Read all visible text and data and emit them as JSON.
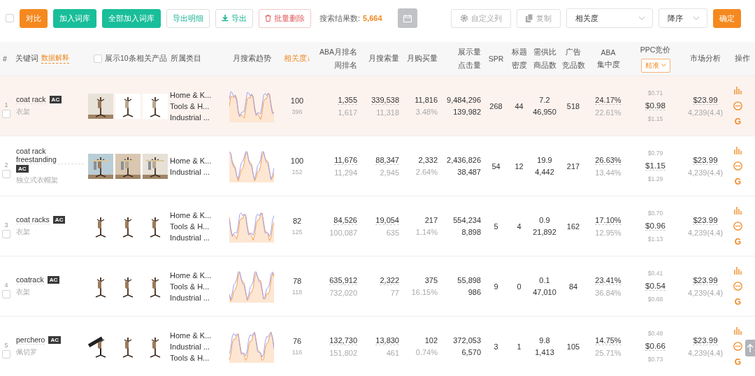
{
  "toolbar": {
    "select_all": {
      "checked": false
    },
    "buttons": [
      {
        "label": "对比",
        "kind": "primary"
      },
      {
        "label": "加入词库",
        "kind": "green"
      },
      {
        "label": "全部加入词库",
        "kind": "green"
      },
      {
        "label": "导出明细",
        "kind": "outline"
      },
      {
        "label": "导出",
        "kind": "download"
      },
      {
        "label": "批量删除",
        "kind": "delete"
      }
    ],
    "result_label": "搜索结果数:",
    "result_count": "5,664",
    "right_buttons": [
      {
        "label": "自定义列",
        "kind": "gear"
      },
      {
        "label": "复制",
        "kind": "copy"
      }
    ],
    "sort_field": "相关度",
    "sort_order": "降序",
    "confirm": "确定"
  },
  "headers": [
    {
      "kind": "text",
      "lines": [
        "#"
      ],
      "sorted": false
    },
    {
      "kind": "link",
      "lines": [
        "关键词"
      ],
      "link": "数据解释",
      "sorted": false
    },
    {
      "kind": "checkbox",
      "lines": [
        "展示10条相关产品"
      ],
      "checked": false,
      "sorted": false
    },
    {
      "kind": "text",
      "lines": [
        "所属类目"
      ],
      "sorted": false
    },
    {
      "kind": "text",
      "lines": [
        "月搜索趋势"
      ],
      "sorted": false
    },
    {
      "kind": "text",
      "lines": [
        "相关度↓"
      ],
      "sorted": true
    },
    {
      "kind": "text",
      "lines": [
        "ABA月排名",
        "周排名"
      ],
      "sorted": false
    },
    {
      "kind": "text",
      "lines": [
        "月搜索量"
      ],
      "sorted": false
    },
    {
      "kind": "text",
      "lines": [
        "月购买量"
      ],
      "sorted": false
    },
    {
      "kind": "text",
      "lines": [
        "展示量",
        "点击量"
      ],
      "sorted": false
    },
    {
      "kind": "text",
      "lines": [
        "SPR"
      ],
      "sorted": false
    },
    {
      "kind": "text",
      "lines": [
        "标题",
        "密度"
      ],
      "sorted": false
    },
    {
      "kind": "text",
      "lines": [
        "需供比",
        "商品数"
      ],
      "sorted": false
    },
    {
      "kind": "text",
      "lines": [
        "广告",
        "竞品数"
      ],
      "sorted": false
    },
    {
      "kind": "text",
      "lines": [
        "ABA",
        "集中度"
      ],
      "sorted": false
    },
    {
      "kind": "dropdown",
      "lines": [
        "PPC竞价"
      ],
      "dropdown": "精准",
      "sorted": false
    },
    {
      "kind": "text",
      "lines": [
        "市场分析"
      ],
      "sorted": false
    },
    {
      "kind": "text",
      "lines": [
        "操作"
      ],
      "sorted": false
    }
  ],
  "rows": [
    {
      "index": "1",
      "keyword": "coat rack",
      "badge": "AC",
      "translation": "衣架",
      "checked": false,
      "selected": true,
      "products": [
        {
          "kind": "picture"
        },
        {
          "kind": "picture"
        },
        {
          "kind": "picture"
        }
      ],
      "categories": [
        "Home & K...",
        "Tools & H...",
        "Industrial ..."
      ],
      "relevance": "100",
      "relevance_sub": "396",
      "aba_month": "1,355",
      "aba_week": "1,617",
      "monthly_search": "339,538",
      "search_sub": "11,318",
      "purchases": "11,816",
      "purchase_rate": "3.48%",
      "impressions": "9,484,296",
      "clicks": "139,982",
      "spr": "268",
      "title_density": "44",
      "supply_ratio": "7.2",
      "product_count": "46,950",
      "ad_products": "518",
      "aba_conc": "24.17%",
      "aba_conc_sub": "22.61%",
      "ppc_low": "$0.71",
      "ppc": "$0.98",
      "ppc_high": "$1.15",
      "price": "$23.99",
      "reviews": "4,239(4.4)",
      "search_mark": "G"
    },
    {
      "index": "2",
      "keyword": "coat rack freestanding",
      "badge": "AC",
      "translation": "独立式衣帽架",
      "checked": false,
      "selected": false,
      "products": [
        {
          "kind": "picture"
        },
        {
          "kind": "picture"
        },
        {
          "kind": "picture"
        }
      ],
      "categories": [
        "Home & K...",
        "Industrial ..."
      ],
      "relevance": "100",
      "relevance_sub": "152",
      "aba_month": "11,676",
      "aba_week": "11,294",
      "monthly_search": "88,347",
      "search_sub": "2,945",
      "purchases": "2,332",
      "purchase_rate": "2.64%",
      "impressions": "2,436,826",
      "clicks": "38,487",
      "spr": "54",
      "title_density": "12",
      "supply_ratio": "19.9",
      "product_count": "4,442",
      "ad_products": "217",
      "aba_conc": "26.63%",
      "aba_conc_sub": "13.44%",
      "ppc_low": "$0.79",
      "ppc": "$1.15",
      "ppc_high": "$1.29",
      "price": "$23.99",
      "reviews": "4,239(4.4)",
      "search_mark": "G"
    },
    {
      "index": "3",
      "keyword": "coat racks",
      "badge": "AC",
      "translation": "衣架",
      "checked": false,
      "selected": false,
      "products": [
        {
          "kind": "picture"
        },
        {
          "kind": "picture"
        },
        {
          "kind": "picture"
        }
      ],
      "categories": [
        "Home & K...",
        "Tools & H...",
        "Industrial ..."
      ],
      "relevance": "82",
      "relevance_sub": "125",
      "aba_month": "84,526",
      "aba_week": "100,087",
      "monthly_search": "19,054",
      "search_sub": "635",
      "purchases": "217",
      "purchase_rate": "1.14%",
      "impressions": "554,234",
      "clicks": "8,898",
      "spr": "5",
      "title_density": "4",
      "supply_ratio": "0.9",
      "product_count": "21,892",
      "ad_products": "162",
      "aba_conc": "17.10%",
      "aba_conc_sub": "12.95%",
      "ppc_low": "$0.70",
      "ppc": "$0.96",
      "ppc_high": "$1.13",
      "price": "$23.99",
      "reviews": "4,239(4.4)",
      "search_mark": "G"
    },
    {
      "index": "4",
      "keyword": "coatrack",
      "badge": "AC",
      "translation": "衣架",
      "checked": false,
      "selected": false,
      "products": [
        {
          "kind": "picture"
        },
        {
          "kind": "picture"
        },
        {
          "kind": "picture"
        }
      ],
      "categories": [
        "Home & K...",
        "Tools & H...",
        "Industrial ..."
      ],
      "relevance": "78",
      "relevance_sub": "118",
      "aba_month": "635,912",
      "aba_week": "732,020",
      "monthly_search": "2,322",
      "search_sub": "77",
      "purchases": "375",
      "purchase_rate": "16.15%",
      "impressions": "55,898",
      "clicks": "986",
      "spr": "9",
      "title_density": "0",
      "supply_ratio": "0.1",
      "product_count": "47,010",
      "ad_products": "84",
      "aba_conc": "23.41%",
      "aba_conc_sub": "36.84%",
      "ppc_low": "$0.41",
      "ppc": "$0.54",
      "ppc_high": "$0.68",
      "price": "$23.99",
      "reviews": "4,239(4.4)",
      "search_mark": "G"
    },
    {
      "index": "5",
      "keyword": "perchero",
      "badge": "AC",
      "translation": "佩切罗",
      "checked": false,
      "selected": false,
      "products": [
        {
          "kind": "picture"
        },
        {
          "kind": "picture"
        },
        {
          "kind": "picture"
        }
      ],
      "categories": [
        "Home & K...",
        "Industrial ...",
        "Tools & H..."
      ],
      "relevance": "76",
      "relevance_sub": "116",
      "aba_month": "132,730",
      "aba_week": "151,802",
      "monthly_search": "13,830",
      "search_sub": "461",
      "purchases": "102",
      "purchase_rate": "0.74%",
      "impressions": "372,053",
      "clicks": "6,570",
      "spr": "3",
      "title_density": "1",
      "supply_ratio": "9.8",
      "product_count": "1,413",
      "ad_products": "105",
      "aba_conc": "14.75%",
      "aba_conc_sub": "25.71%",
      "ppc_low": "$0.48",
      "ppc": "$0.66",
      "ppc_high": "$0.73",
      "price": "$23.99",
      "reviews": "4,239(4.4)",
      "search_mark": "G"
    }
  ]
}
